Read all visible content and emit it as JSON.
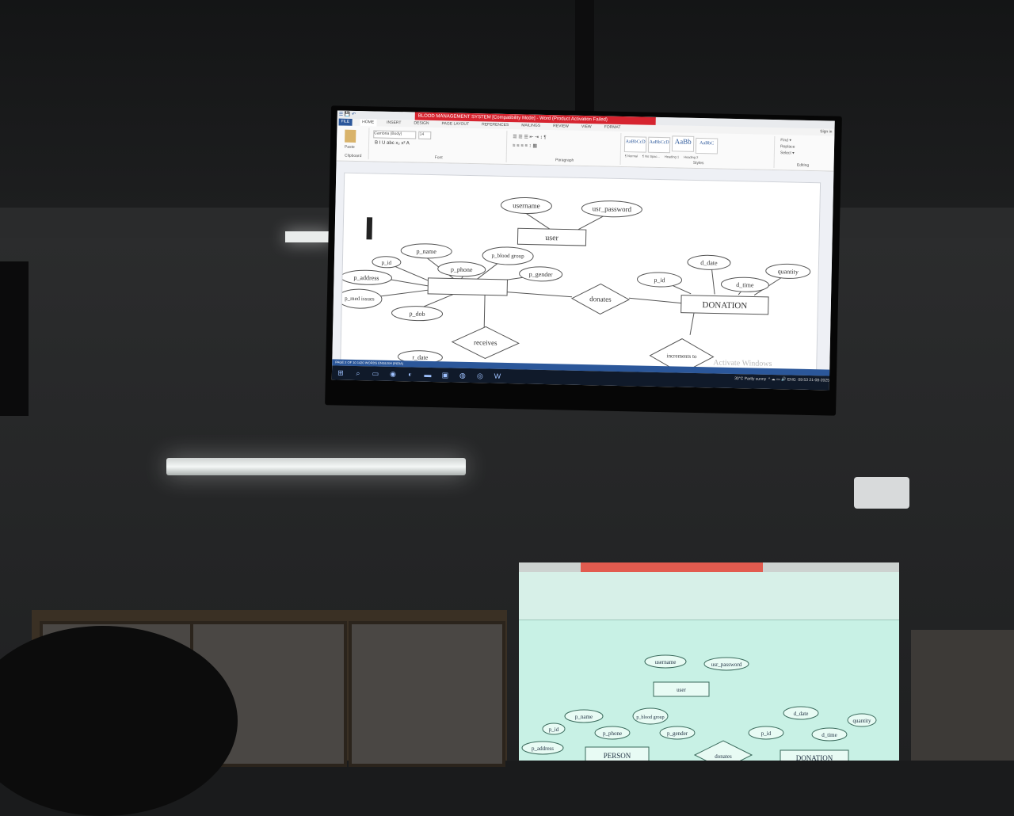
{
  "word": {
    "quick_access": "☰ 💾 ↶",
    "window_title": "BLOOD MANAGEMENT SYSTEM [Compatibility Mode] - Word (Product Activation Failed)",
    "tabs": [
      "FILE",
      "HOME",
      "INSERT",
      "DESIGN",
      "PAGE LAYOUT",
      "REFERENCES",
      "MAILINGS",
      "REVIEW",
      "VIEW",
      "FORMAT"
    ],
    "font_name": "Cambria (Body)",
    "font_size": "14",
    "groups": {
      "font": "Font",
      "paragraph": "Paragraph",
      "styles": "Styles",
      "editing": "Editing",
      "clipboard": "Clipboard"
    },
    "paste_label": "Paste",
    "styles": [
      "AaBbCcD",
      "AaBbCcD",
      "AaBb",
      "AaBbC"
    ],
    "style_names": [
      "¶ Normal",
      "¶ No Spac...",
      "Heading 1",
      "Heading 2"
    ],
    "editing": [
      "Find ▾",
      "Replace",
      "Select ▾"
    ],
    "sign_in": "Sign in",
    "status": "PAGE 2 OF 10   1420 WORDS   ENGLISH (INDIA)",
    "watermark": "Activate Windows"
  },
  "taskbar": {
    "weather": "30°C  Partly sunny",
    "lang": "ENG",
    "time": "09:53",
    "date": "21-08-2025"
  },
  "diagram": {
    "entities": [
      "user",
      "DONATION"
    ],
    "attributes": [
      "username",
      "usr_password",
      "p_name",
      "p_blood group",
      "p_id",
      "p_phone",
      "p_gender",
      "p_address",
      "p_med issues",
      "p_dob",
      "d_date",
      "quantity",
      "p_id",
      "d_time",
      "r_date"
    ],
    "relations": [
      "donates",
      "receives",
      "increments to"
    ]
  },
  "monitor2": {
    "entities": [
      "user",
      "PERSON",
      "DONATION"
    ],
    "attributes": [
      "username",
      "usr_password",
      "p_name",
      "p_blood group",
      "p_id",
      "p_phone",
      "p_gender",
      "p_address",
      "d_date",
      "quantity",
      "p_id",
      "d_time"
    ],
    "relations": [
      "donates"
    ]
  }
}
